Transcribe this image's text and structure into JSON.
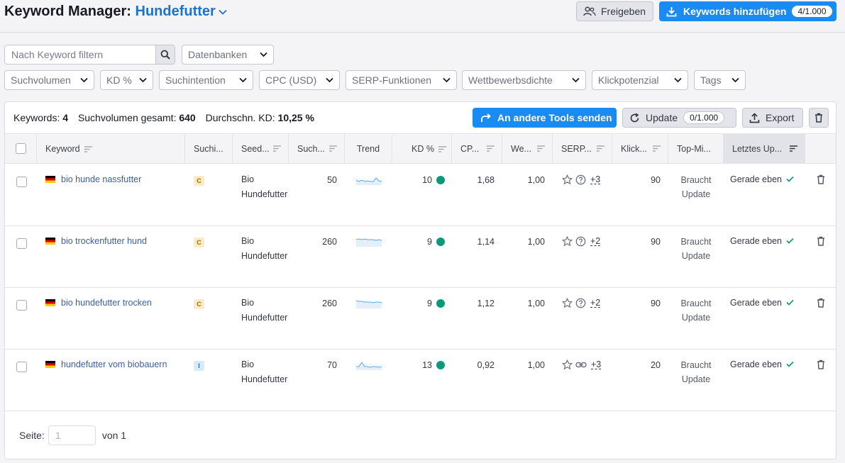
{
  "header": {
    "title_prefix": "Keyword Manager:",
    "project_name": "Hundefutter",
    "share_label": "Freigeben",
    "add_keywords_label": "Keywords hinzufügen",
    "add_keywords_count": "4/1.000"
  },
  "filters": {
    "search_placeholder": "Nach Keyword filtern",
    "databases_label": "Datenbanken",
    "dropdowns": [
      "Suchvolumen",
      "KD %",
      "Suchintention",
      "CPC (USD)",
      "SERP-Funktionen",
      "Wettbewerbsdichte",
      "Klickpotenzial",
      "Tags"
    ]
  },
  "summary": {
    "keywords_label": "Keywords:",
    "keywords_value": "4",
    "volume_label": "Suchvolumen gesamt:",
    "volume_value": "640",
    "kd_label": "Durchschn. KD:",
    "kd_value": "10,25 %"
  },
  "actions": {
    "send_label": "An andere Tools senden",
    "update_label": "Update",
    "update_count": "0/1.000",
    "export_label": "Export"
  },
  "table": {
    "columns": [
      "Keyword",
      "Suchi...",
      "Seed...",
      "Such...",
      "Trend",
      "KD %",
      "CP...",
      "We...",
      "SERP...",
      "Klick...",
      "Top-Mi...",
      "Letztes Up..."
    ],
    "rows": [
      {
        "keyword": "bio hunde nassfutter",
        "intent": "C",
        "intent_kind": "commercial",
        "seed": "Bio Hundefutter",
        "volume": "50",
        "kd": "10",
        "cpc": "1,68",
        "com": "1,00",
        "serp_more": "+3",
        "serp_second_icon": "question-icon",
        "clicks": "90",
        "top1": "Braucht",
        "top2": "Update",
        "last_update": "Gerade eben"
      },
      {
        "keyword": "bio trockenfutter hund",
        "intent": "C",
        "intent_kind": "commercial",
        "seed": "Bio Hundefutter",
        "volume": "260",
        "kd": "9",
        "cpc": "1,14",
        "com": "1,00",
        "serp_more": "+2",
        "serp_second_icon": "question-icon",
        "clicks": "90",
        "top1": "Braucht",
        "top2": "Update",
        "last_update": "Gerade eben"
      },
      {
        "keyword": "bio hundefutter trocken",
        "intent": "C",
        "intent_kind": "commercial",
        "seed": "Bio Hundefutter",
        "volume": "260",
        "kd": "9",
        "cpc": "1,12",
        "com": "1,00",
        "serp_more": "+2",
        "serp_second_icon": "question-icon",
        "clicks": "90",
        "top1": "Braucht",
        "top2": "Update",
        "last_update": "Gerade eben"
      },
      {
        "keyword": "hundefutter vom biobauern",
        "intent": "I",
        "intent_kind": "informational",
        "seed": "Bio Hundefutter",
        "volume": "70",
        "kd": "13",
        "cpc": "0,92",
        "com": "1,00",
        "serp_more": "+3",
        "serp_second_icon": "link-icon",
        "clicks": "20",
        "top1": "Braucht",
        "top2": "Update",
        "last_update": "Gerade eben"
      }
    ]
  },
  "pagination": {
    "page_label": "Seite:",
    "page_value": "1",
    "of_label": "von 1"
  },
  "colors": {
    "brand_blue": "#1a8bf2",
    "link_blue": "#3a5fa0",
    "kd_green": "#0b9a78",
    "check_green": "#0b9a78"
  }
}
